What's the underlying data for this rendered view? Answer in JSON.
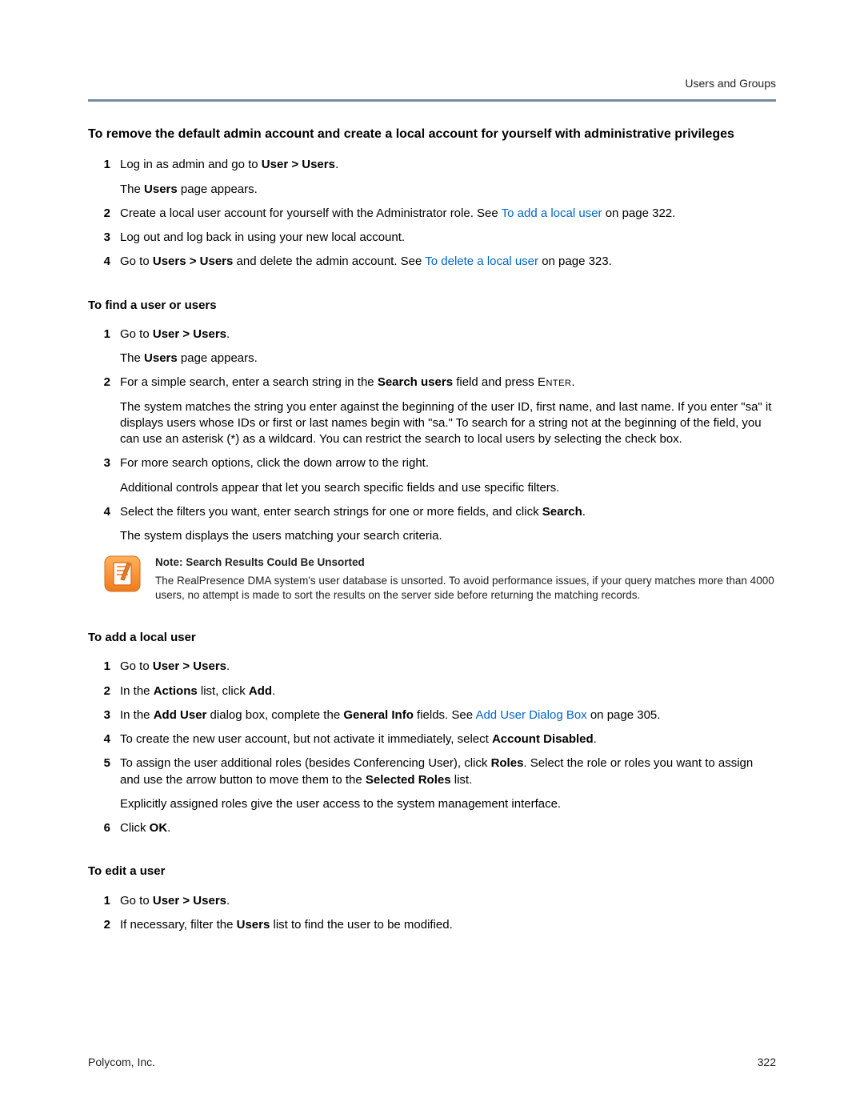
{
  "header": {
    "section": "Users and Groups"
  },
  "s1": {
    "title": "To remove the default admin account and create a local account for yourself with administrative privileges",
    "step1_a": "Log in as admin and go to ",
    "step1_b": "User > Users",
    "step1_c": ".",
    "step1_p2_a": "The ",
    "step1_p2_b": "Users",
    "step1_p2_c": " page appears.",
    "step2_a": "Create a local user account for yourself with the Administrator role. See ",
    "step2_link": "To add a local user",
    "step2_b": " on page 322.",
    "step3": "Log out and log back in using your new local account.",
    "step4_a": "Go to ",
    "step4_b": "Users > Users",
    "step4_c": " and delete the admin account. See ",
    "step4_link": "To delete a local user",
    "step4_d": " on page 323."
  },
  "s2": {
    "title": "To find a user or users",
    "step1_a": "Go to ",
    "step1_b": "User > Users",
    "step1_c": ".",
    "step1_p2_a": "The ",
    "step1_p2_b": "Users",
    "step1_p2_c": " page appears.",
    "step2_a": "For a simple search, enter a search string in the ",
    "step2_b": "Search users",
    "step2_c": " field and press ",
    "step2_d": "Enter",
    "step2_e": ".",
    "step2_p2": "The system matches the string you enter against the beginning of the user ID, first name, and last name. If you enter \"sa\" it displays users whose IDs or first or last names begin with \"sa.\" To search for a string not at the beginning of the field, you can use an asterisk (*) as a wildcard. You can restrict the search to local users by selecting the check box.",
    "step3": "For more search options, click the down arrow to the right.",
    "step3_p2": "Additional controls appear that let you search specific fields and use specific filters.",
    "step4_a": "Select the filters you want, enter search strings for one or more fields, and click ",
    "step4_b": "Search",
    "step4_c": ".",
    "step4_p2": "The system displays the users matching your search criteria."
  },
  "note": {
    "title": "Note: Search Results Could Be Unsorted",
    "body": "The RealPresence DMA system's user database is unsorted. To avoid performance issues, if your query matches more than 4000 users, no attempt is made to sort the results on the server side before returning the matching records."
  },
  "s3": {
    "title": "To add a local user",
    "step1_a": "Go to ",
    "step1_b": "User > Users",
    "step1_c": ".",
    "step2_a": "In the ",
    "step2_b": "Actions",
    "step2_c": " list, click ",
    "step2_d": "Add",
    "step2_e": ".",
    "step3_a": "In the ",
    "step3_b": "Add User",
    "step3_c": " dialog box, complete the ",
    "step3_d": "General Info",
    "step3_e": " fields. See ",
    "step3_link": "Add User Dialog Box",
    "step3_f": " on page 305.",
    "step4_a": "To create the new user account, but not activate it immediately, select ",
    "step4_b": "Account Disabled",
    "step4_c": ".",
    "step5_a": "To assign the user additional roles (besides Conferencing User), click ",
    "step5_b": "Roles",
    "step5_c": ". Select the role or roles you want to assign and use the arrow button to move them to the ",
    "step5_d": "Selected Roles",
    "step5_e": " list.",
    "step5_p2": "Explicitly assigned roles give the user access to the system management interface.",
    "step6_a": "Click ",
    "step6_b": "OK",
    "step6_c": "."
  },
  "s4": {
    "title": "To edit a user",
    "step1_a": "Go to ",
    "step1_b": "User > Users",
    "step1_c": ".",
    "step2_a": "If necessary, filter the ",
    "step2_b": "Users",
    "step2_c": " list to find the user to be modified."
  },
  "footer": {
    "company": "Polycom, Inc.",
    "page": "322"
  }
}
